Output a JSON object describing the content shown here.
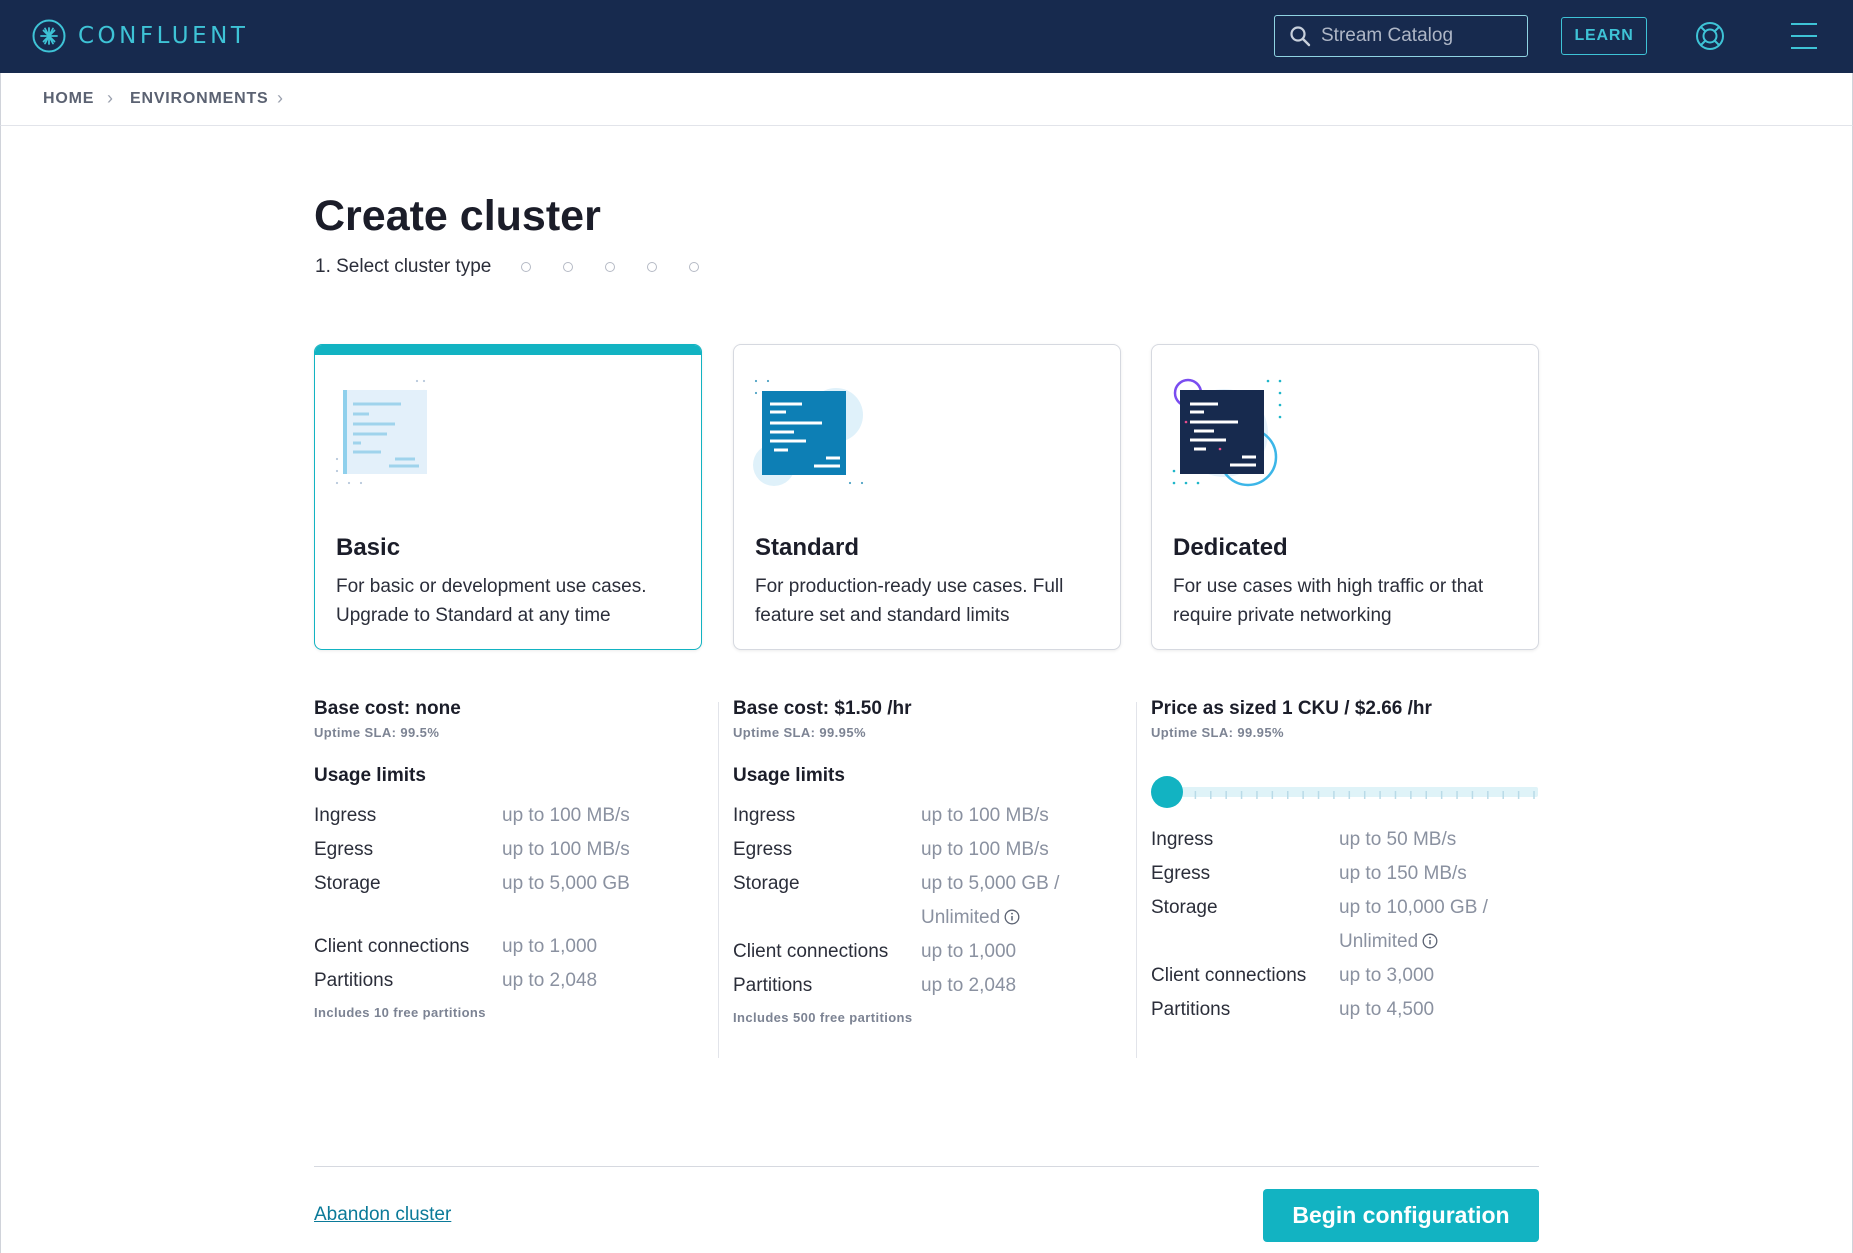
{
  "nav": {
    "brand": "CONFLUENT",
    "search_placeholder": "Stream Catalog",
    "learn_label": "LEARN",
    "icons": [
      "confluent-logo-icon",
      "search-icon",
      "help-lifebuoy-icon",
      "hamburger-menu-icon"
    ],
    "colors": {
      "nav_bg": "#172a4e",
      "accent": "#3ec3d6"
    }
  },
  "breadcrumb": {
    "items": [
      {
        "label": "HOME"
      },
      {
        "label": "ENVIRONMENTS"
      }
    ],
    "separator": "›"
  },
  "page": {
    "title": "Create cluster",
    "step_label": "1. Select cluster type",
    "steps_remaining": 5
  },
  "cards": [
    {
      "name": "Basic",
      "description": "For basic or development use cases. Upgrade to Standard at any time",
      "selected": true
    },
    {
      "name": "Standard",
      "description": "For production-ready use cases. Full feature set and standard limits",
      "selected": false
    },
    {
      "name": "Dedicated",
      "description": "For use cases with high traffic or that require private networking",
      "selected": false
    }
  ],
  "details": {
    "basic": {
      "cost": "Base cost: none",
      "sla": "Uptime SLA: 99.5%",
      "usage_title": "Usage limits",
      "rows": [
        {
          "label": "Ingress",
          "value": "up to 100 MB/s"
        },
        {
          "label": "Egress",
          "value": "up to 100 MB/s"
        },
        {
          "label": "Storage",
          "value": "up to 5,000 GB"
        },
        {
          "label": "Client connections",
          "value": "up to 1,000"
        },
        {
          "label": "Partitions",
          "value": "up to 2,048"
        }
      ],
      "note": "Includes 10 free partitions"
    },
    "standard": {
      "cost": "Base cost: $1.50 /hr",
      "sla": "Uptime SLA: 99.95%",
      "usage_title": "Usage limits",
      "rows": [
        {
          "label": "Ingress",
          "value": "up to 100 MB/s"
        },
        {
          "label": "Egress",
          "value": "up to 100 MB/s"
        },
        {
          "label": "Storage",
          "value": "up to 5,000 GB /",
          "value2": "Unlimited"
        },
        {
          "label": "Client connections",
          "value": "up to 1,000"
        },
        {
          "label": "Partitions",
          "value": "up to 2,048"
        }
      ],
      "note": "Includes 500 free partitions"
    },
    "dedicated": {
      "cost": "Price as sized 1 CKU / $2.66 /hr",
      "sla": "Uptime SLA: 99.95%",
      "slider": {
        "value": 1,
        "min": 1,
        "ticks": 24
      },
      "rows": [
        {
          "label": "Ingress",
          "value": "up to 50 MB/s"
        },
        {
          "label": "Egress",
          "value": "up to 150 MB/s"
        },
        {
          "label": "Storage",
          "value": "up to 10,000 GB /",
          "value2": "Unlimited"
        },
        {
          "label": "Client connections",
          "value": "up to 3,000"
        },
        {
          "label": "Partitions",
          "value": "up to 4,500"
        }
      ]
    }
  },
  "footer": {
    "abandon_label": "Abandon cluster",
    "begin_label": "Begin configuration",
    "colors": {
      "primary": "#12b3c2",
      "link": "#0b7a99"
    }
  }
}
